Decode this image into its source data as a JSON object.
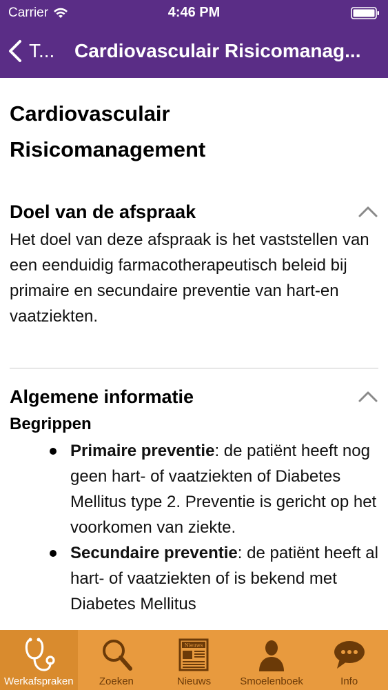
{
  "statusbar": {
    "carrier": "Carrier",
    "time": "4:46 PM"
  },
  "navbar": {
    "back_label": "T...",
    "title": "Cardiovasculair Risicomanag..."
  },
  "page": {
    "title": "Cardiovasculair Risicomanagement"
  },
  "sections": [
    {
      "title": "Doel van de afspraak",
      "body": "Het doel van deze afspraak is het vaststellen van een eenduidig farmacotherapeutisch beleid bij primaire en secundaire preventie van hart-en vaatziekten."
    },
    {
      "title": "Algemene informatie",
      "subheading": "Begrippen",
      "items": [
        {
          "term": "Primaire preventie",
          "text": ": de patiënt heeft nog geen hart- of vaatziekten of Diabetes Mellitus type 2. Preventie is gericht op het voorkomen van ziekte."
        },
        {
          "term": "Secundaire preventie",
          "text": ": de patiënt heeft al hart- of vaatziekten of is bekend met Diabetes Mellitus"
        }
      ]
    }
  ],
  "tabbar": {
    "tabs": [
      {
        "label": "Werkafspraken",
        "icon": "stethoscope-icon",
        "active": true
      },
      {
        "label": "Zoeken",
        "icon": "search-icon",
        "active": false
      },
      {
        "label": "Nieuws",
        "icon": "newspaper-icon",
        "active": false,
        "icon_text": "Nieuws"
      },
      {
        "label": "Smoelenboek",
        "icon": "person-icon",
        "active": false
      },
      {
        "label": "Info",
        "icon": "chat-bubble-icon",
        "active": false
      }
    ]
  },
  "colors": {
    "nav_background": "#5a2d86",
    "tabbar_background": "#e89a3e",
    "tab_icon": "#6b3a08"
  }
}
